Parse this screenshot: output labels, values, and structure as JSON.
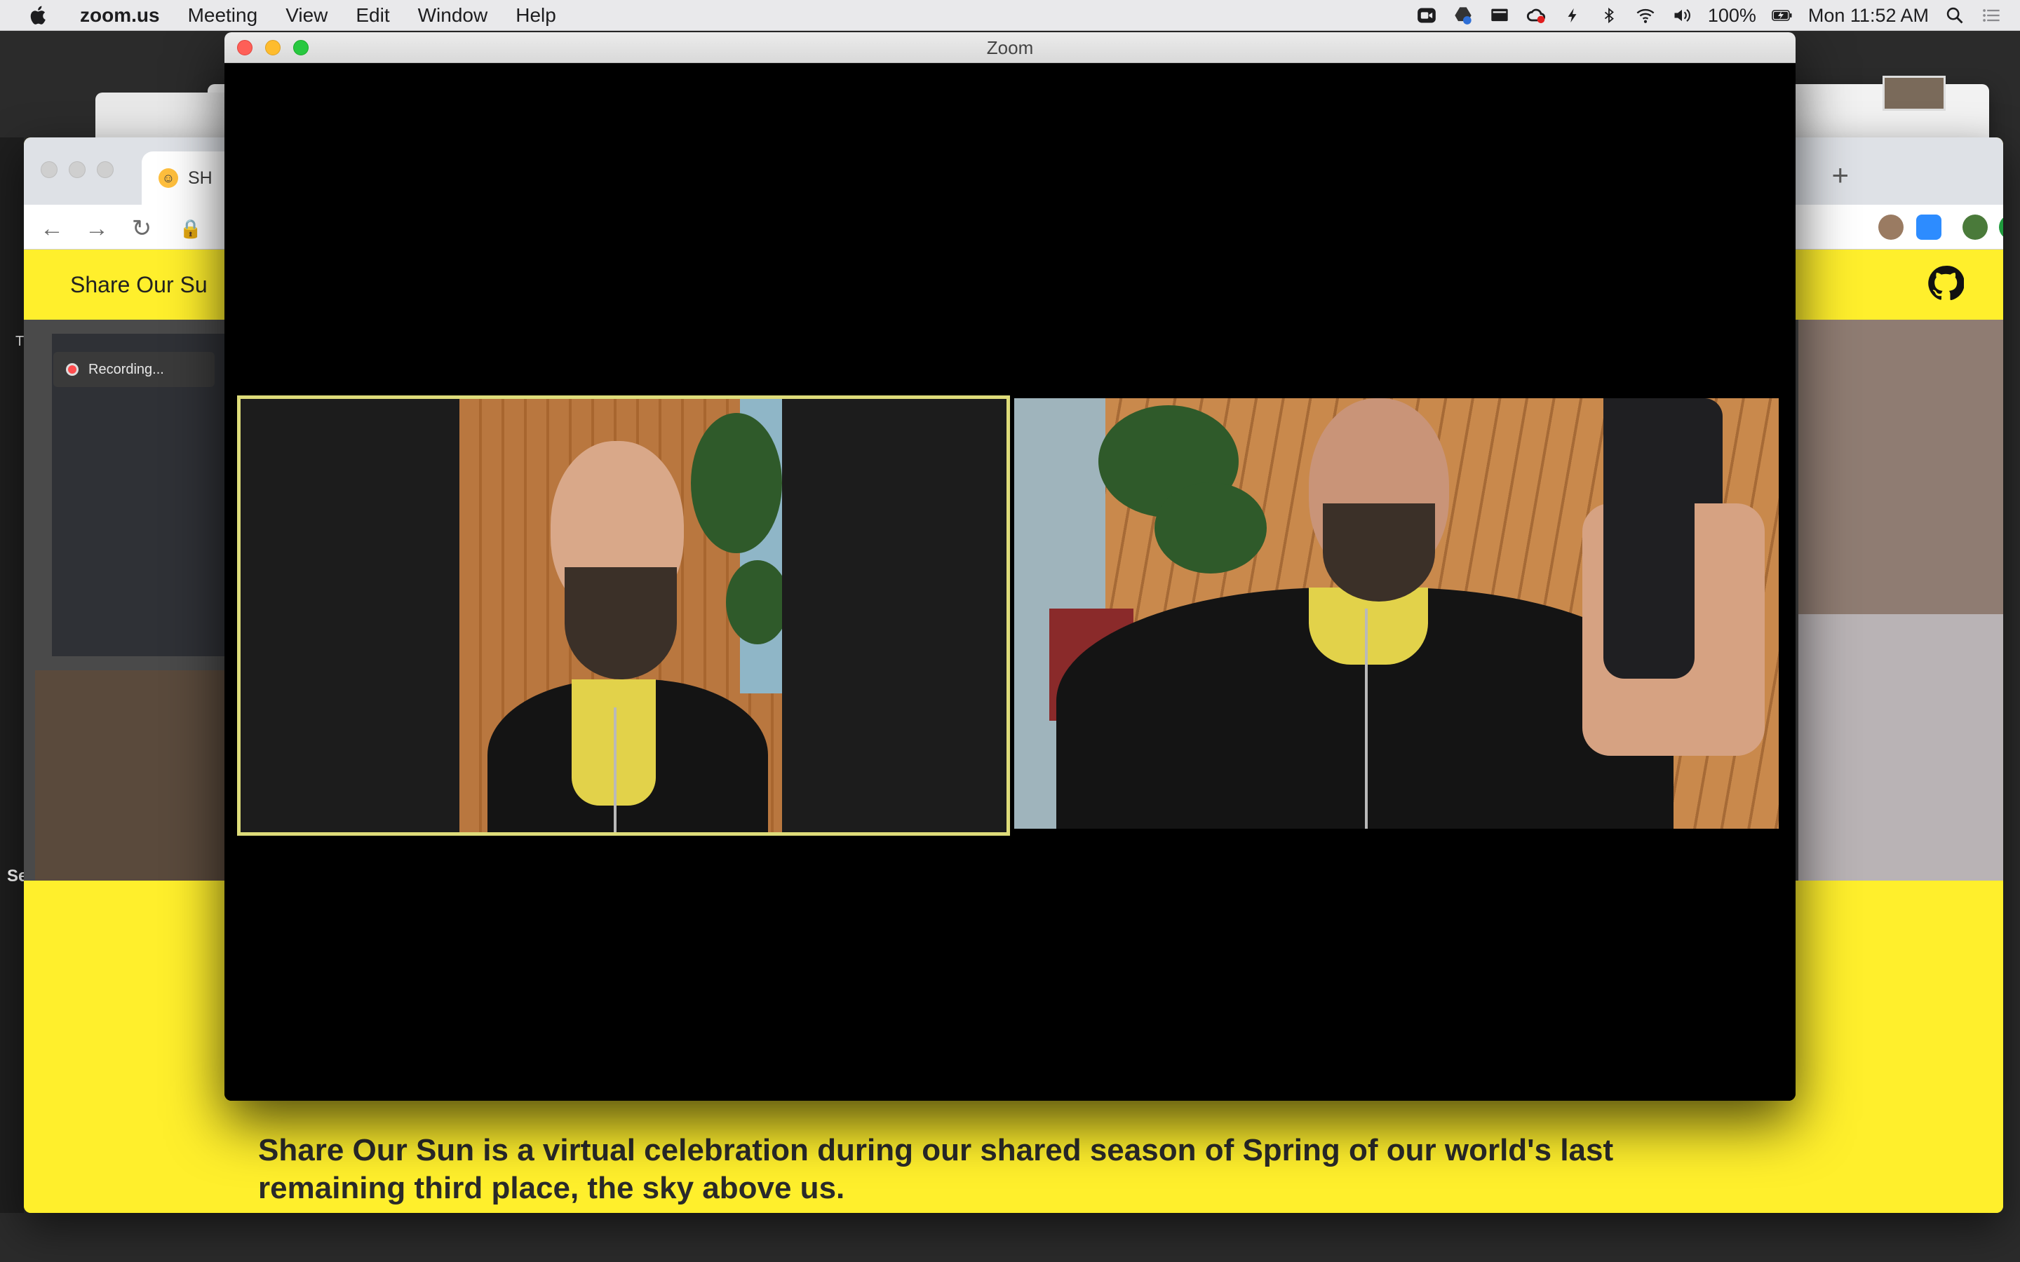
{
  "menubar": {
    "app_name": "zoom.us",
    "menus": [
      "Meeting",
      "View",
      "Edit",
      "Window",
      "Help"
    ],
    "battery": "100%",
    "clock": "Mon 11:52 AM",
    "status_icons": [
      "zoom-icon",
      "google-drive-icon",
      "display-icon",
      "creative-cloud-icon",
      "lightning-icon",
      "bluetooth-icon",
      "wifi-icon",
      "volume-icon",
      "battery-icon",
      "spotlight-icon",
      "notification-center-icon"
    ]
  },
  "zoom": {
    "window_title": "Zoom"
  },
  "browser": {
    "tab_title": "SH",
    "new_tab_label": "+",
    "site_title": "Share Our Su",
    "recording_label": "Recording...",
    "body_text": "Share Our Sun is a virtual celebration during our shared season of Spring of our world's last remaining third place, the sky above us.",
    "sidebar_letters": [
      "T",
      "Se"
    ]
  },
  "colors": {
    "site_yellow": "#ffef2c",
    "active_speaker_border": "#dedc7a",
    "zoom_bg": "#000000"
  }
}
